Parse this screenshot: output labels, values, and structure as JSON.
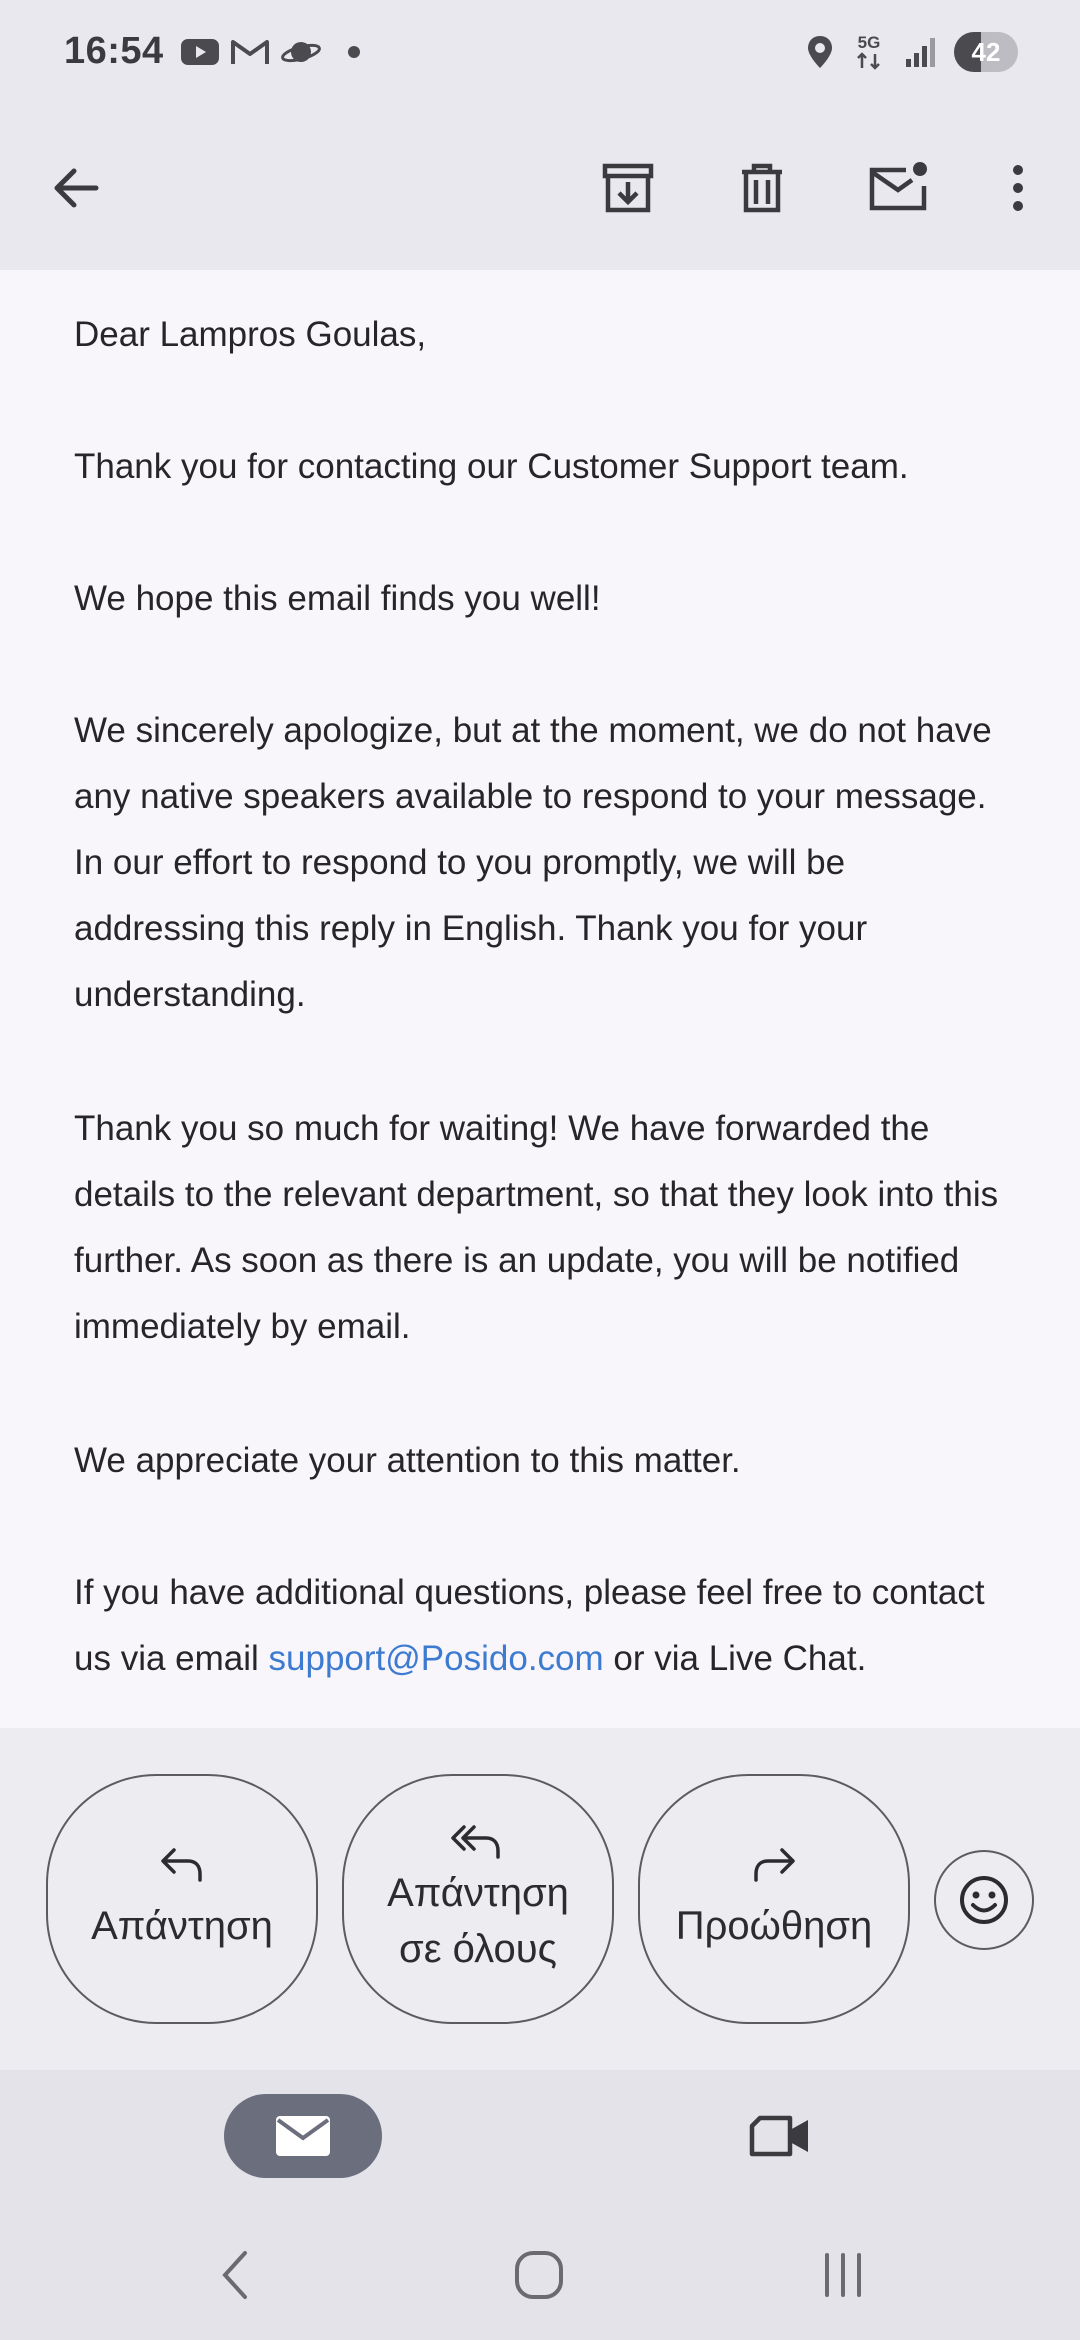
{
  "status_bar": {
    "time": "16:54",
    "network": "5G",
    "battery": "42",
    "battery_level": 0.42,
    "notification_icons": [
      "youtube-icon",
      "gmail-icon",
      "saturn-icon",
      "dot-icon"
    ],
    "system_icons": [
      "location-icon",
      "5g-icon",
      "signal-icon",
      "battery-icon"
    ]
  },
  "toolbar": {
    "icons": [
      "back-arrow-icon",
      "archive-icon",
      "delete-icon",
      "mark-unread-icon",
      "more-vert-icon"
    ]
  },
  "email": {
    "greeting": "Dear Lampros Goulas,",
    "p1": "Thank you for contacting our Customer Support team.",
    "p2": "We hope this email finds you well!",
    "p3": "We sincerely apologize, but at the moment, we do not have any native speakers available to respond to your message. In our effort to respond to you promptly, we will be addressing this reply in English. Thank you for your understanding.",
    "p4": "Thank you so much for waiting! We have forwarded the details to the relevant department, so that they look into this further. As soon as there is an update, you will be notified immediately by email.",
    "p5": "We appreciate your attention to this matter.",
    "p6_before": "If you have additional questions, please feel free to contact us via email ",
    "p6_link": "support@Posido.com",
    "p6_after": " or via Live Chat."
  },
  "actions": {
    "reply": "Απάντηση",
    "reply_all_line1": "Απάντηση",
    "reply_all_line2": "σε όλους",
    "forward": "Προώθηση"
  },
  "bottom_nav": {
    "items": [
      "mail-icon",
      "video-icon"
    ],
    "selected": "mail-icon"
  },
  "colors": {
    "background": "#e9e8ee",
    "content_bg": "#f8f6fb",
    "link": "#3d7bd0",
    "nav_pill": "#6b6e7d"
  }
}
